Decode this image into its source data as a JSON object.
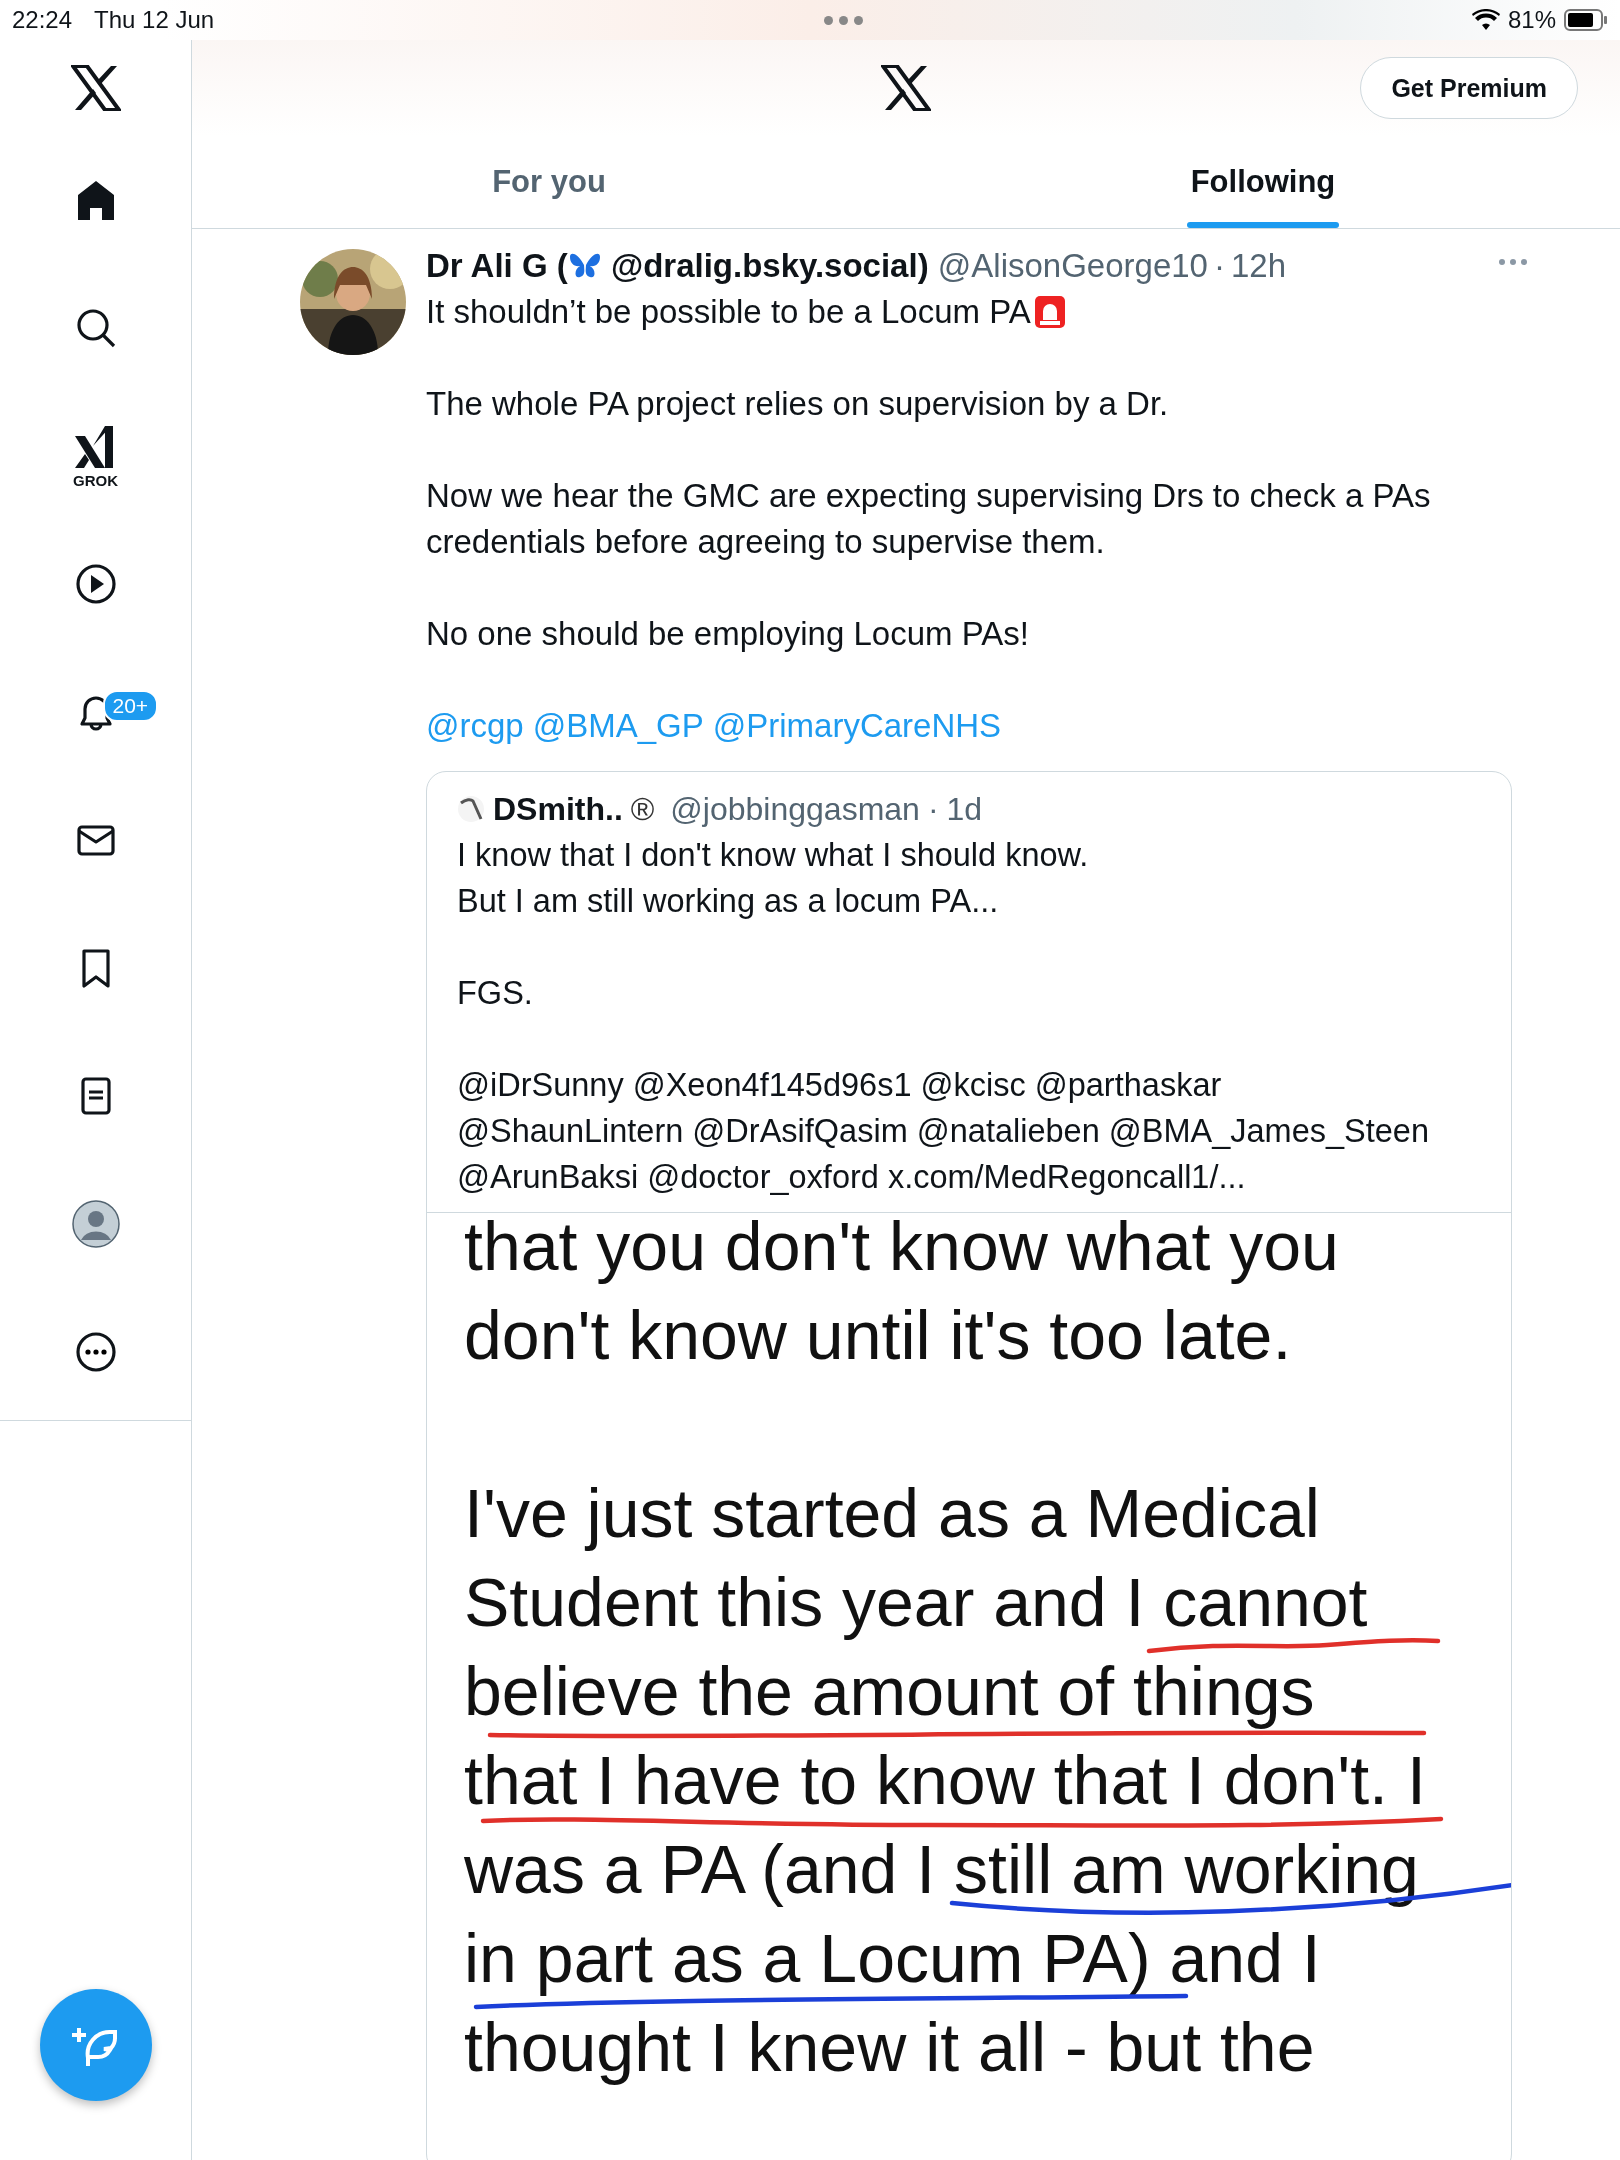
{
  "status_bar": {
    "time": "22:24",
    "date": "Thu 12 Jun",
    "battery": "81%"
  },
  "sidebar": {
    "grok_label": "GROK",
    "notification_badge": "20+"
  },
  "header": {
    "premium_button": "Get Premium"
  },
  "tabs": [
    {
      "label": "For you",
      "selected": false
    },
    {
      "label": "Following",
      "selected": true
    }
  ],
  "tweet": {
    "name_start": "Dr Ali G (",
    "name_end": "@dralig.bsky.social)",
    "handle": "@AlisonGeorge10",
    "separator": "·",
    "time": "12h",
    "paragraphs": [
      "It shouldn’t be possible to be a Locum PA",
      "The whole PA project relies on supervision by a Dr.",
      "Now we hear the GMC are expecting supervising Drs to check a PAs\ncredentials before agreeing to supervise them.",
      "No one should be employing Locum PAs!"
    ],
    "mentions": [
      "@rcgp",
      "@BMA_GP",
      "@PrimaryCareNHS"
    ],
    "quote": {
      "name": "DSmith..",
      "mark": "®",
      "handle": "@jobbinggasman",
      "separator": "·",
      "time": "1d",
      "paragraphs": [
        "I know that I don't know what I should know.\nBut I am still working as a locum PA...",
        "FGS.",
        "@iDrSunny @Xeon4f145d96s1 @kcisc @parthaskar\n@ShaunLintern @DrAsifQasim @natalieben @BMA_James_Steen\n@ArunBaksi @doctor_oxford x.com/MedRegoncall1/..."
      ],
      "image_paragraphs": [
        "that you don't know what you\ndon't know until it's too late.",
        "I've just started as a Medical\nStudent this year and I cannot\nbelieve the amount of things\nthat I have to know that I don't. I\nwas a PA (and I still am working\nin part as a Locum PA) and I\nthought I knew it all - but the"
      ]
    }
  }
}
